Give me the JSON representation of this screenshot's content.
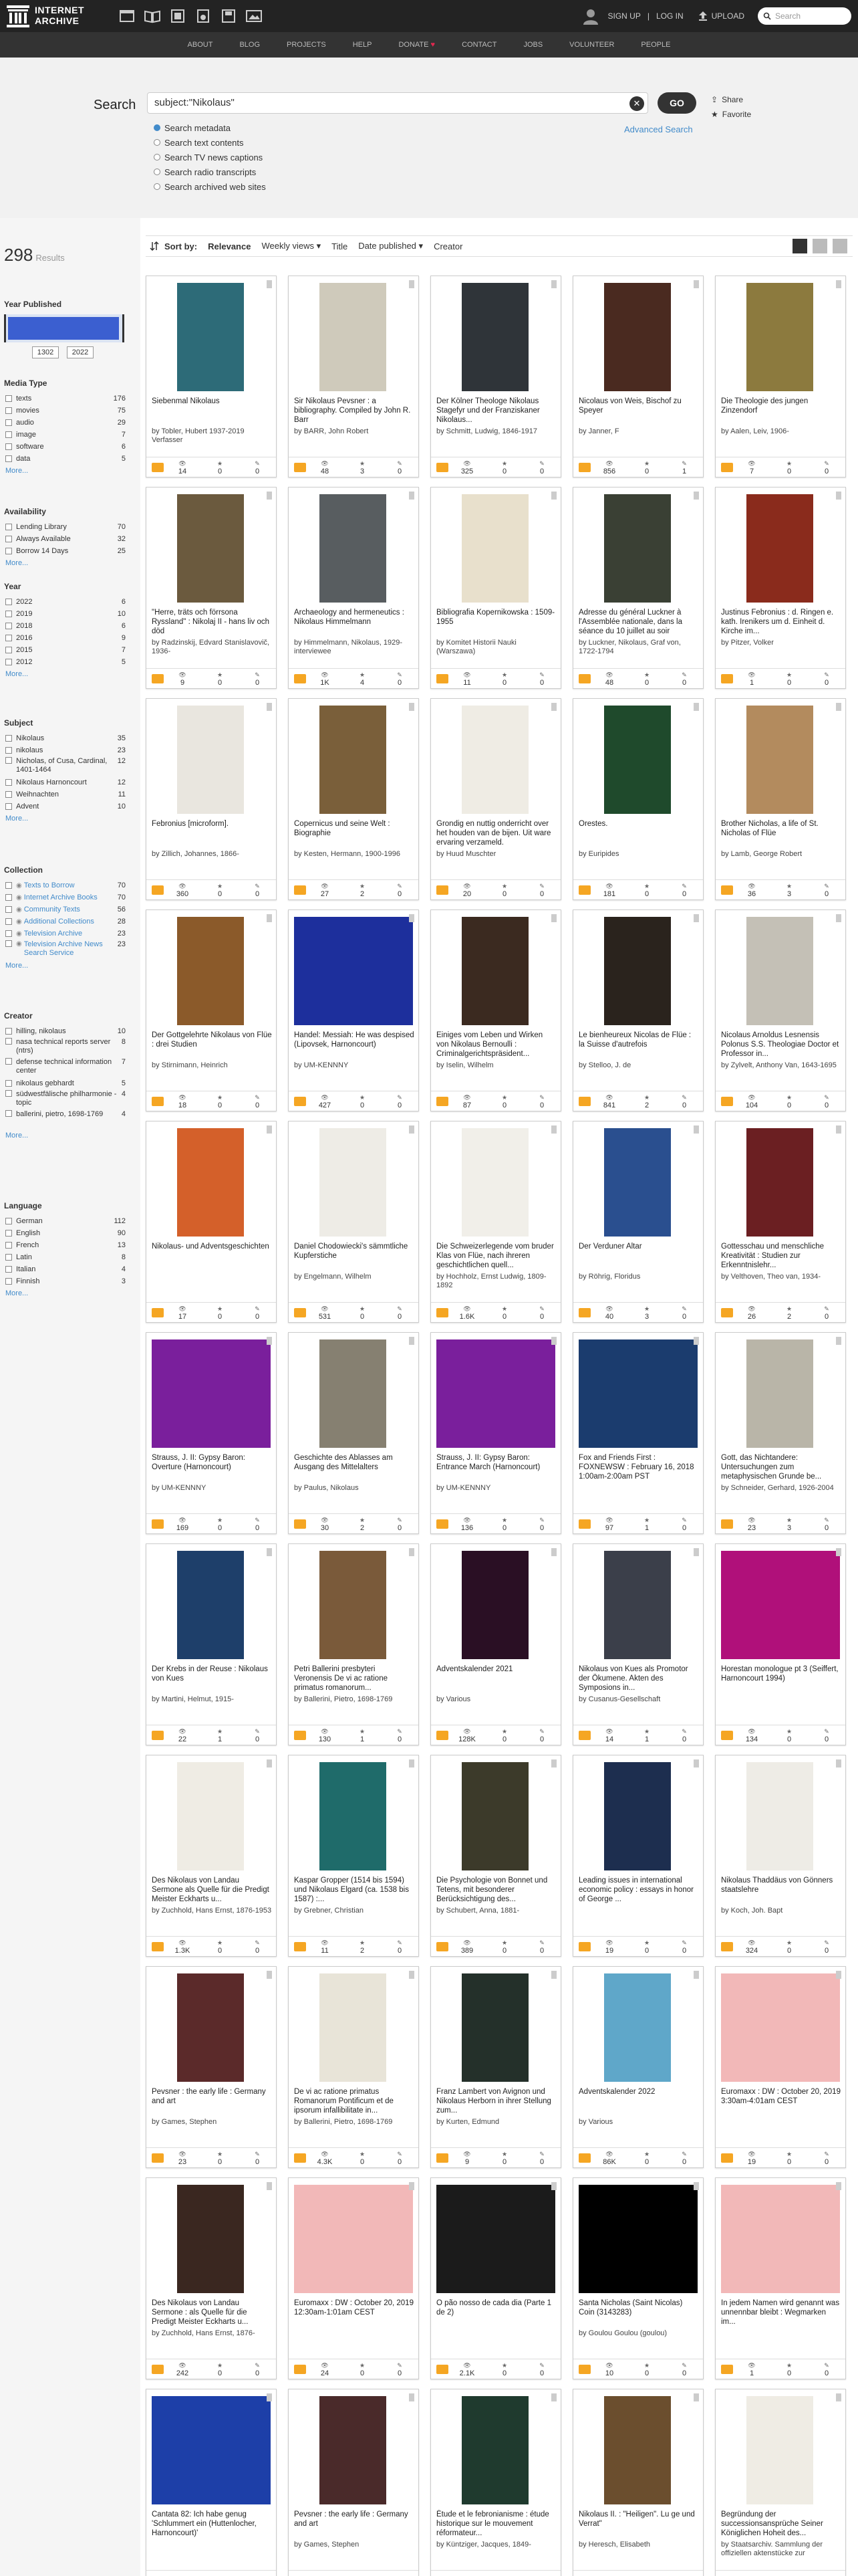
{
  "header": {
    "logo_text_1": "INTERNET",
    "logo_text_2": "ARCHIVE",
    "signup": "SIGN UP",
    "login": "LOG IN",
    "upload": "UPLOAD",
    "search_placeholder": "Search",
    "nav": [
      "ABOUT",
      "BLOG",
      "PROJECTS",
      "HELP",
      "DONATE",
      "CONTACT",
      "JOBS",
      "VOLUNTEER",
      "PEOPLE"
    ]
  },
  "search": {
    "label": "Search",
    "query": "subject:\"Nikolaus\"",
    "go": "GO",
    "advanced": "Advanced Search",
    "share": "Share",
    "favorite": "Favorite",
    "options": [
      "Search metadata",
      "Search text contents",
      "Search TV news captions",
      "Search radio transcripts",
      "Search archived web sites"
    ]
  },
  "results": {
    "count": "298",
    "label": "Results"
  },
  "sort": {
    "label": "Sort by:",
    "options": [
      "Relevance",
      "Weekly views",
      "Title",
      "Date published",
      "Creator"
    ]
  },
  "facets": {
    "year_title": "Year Published",
    "year_from": "1302",
    "year_to": "2022",
    "media_title": "Media Type",
    "media": [
      [
        "texts",
        "176"
      ],
      [
        "movies",
        "75"
      ],
      [
        "audio",
        "29"
      ],
      [
        "image",
        "7"
      ],
      [
        "software",
        "6"
      ],
      [
        "data",
        "5"
      ]
    ],
    "avail_title": "Availability",
    "avail": [
      [
        "Lending Library",
        "70"
      ],
      [
        "Always Available",
        "32"
      ],
      [
        "Borrow 14 Days",
        "25"
      ]
    ],
    "year2_title": "Year",
    "years": [
      [
        "2022",
        "6"
      ],
      [
        "2019",
        "10"
      ],
      [
        "2018",
        "6"
      ],
      [
        "2016",
        "9"
      ],
      [
        "2015",
        "7"
      ],
      [
        "2012",
        "5"
      ]
    ],
    "subject_title": "Subject",
    "subjects": [
      [
        "Nikolaus",
        "35"
      ],
      [
        "nikolaus",
        "23"
      ],
      [
        "Nicholas, of Cusa, Cardinal, 1401-1464",
        "12"
      ],
      [
        "Nikolaus Harnoncourt",
        "12"
      ],
      [
        "Weihnachten",
        "11"
      ],
      [
        "Advent",
        "10"
      ]
    ],
    "collection_title": "Collection",
    "collections": [
      [
        "Texts to Borrow",
        "70"
      ],
      [
        "Internet Archive Books",
        "70"
      ],
      [
        "Community Texts",
        "56"
      ],
      [
        "Additional Collections",
        "28"
      ],
      [
        "Television Archive",
        "23"
      ],
      [
        "Television Archive News Search Service",
        "23"
      ]
    ],
    "creator_title": "Creator",
    "creators": [
      [
        "hilling, nikolaus",
        "10"
      ],
      [
        "nasa technical reports server (ntrs)",
        "8"
      ],
      [
        "defense technical information center",
        "7"
      ],
      [
        "nikolaus gebhardt",
        "5"
      ],
      [
        "südwestfälische philharmonie - topic",
        "4"
      ],
      [
        "ballerini, pietro, 1698-1769",
        "4"
      ]
    ],
    "language_title": "Language",
    "languages": [
      [
        "German",
        "112"
      ],
      [
        "English",
        "90"
      ],
      [
        "French",
        "13"
      ],
      [
        "Latin",
        "8"
      ],
      [
        "Italian",
        "4"
      ],
      [
        "Finnish",
        "3"
      ]
    ],
    "more": "More..."
  },
  "items": [
    {
      "title": "Siebenmal Nikolaus",
      "by": "by Tobler, Hubert 1937-2019 Verfasser",
      "views": "14",
      "favs": "0",
      "reviews": "0",
      "color": "#2d6b78"
    },
    {
      "title": "Sir Nikolaus Pevsner : a bibliography. Compiled by John R. Barr",
      "by": "by BARR, John Robert",
      "views": "48",
      "favs": "3",
      "reviews": "0",
      "color": "#cfcabb"
    },
    {
      "title": "Der Kölner Theologe Nikolaus Stagefyr und der Franziskaner Nikolaus...",
      "by": "by Schmitt, Ludwig, 1846-1917",
      "views": "325",
      "favs": "0",
      "reviews": "0",
      "color": "#2f3439"
    },
    {
      "title": "Nicolaus von Weis, Bischof zu Speyer",
      "by": "by Janner, F",
      "views": "856",
      "favs": "0",
      "reviews": "1",
      "color": "#4a2a20"
    },
    {
      "title": "Die Theologie des jungen Zinzendorf",
      "by": "by Aalen, Leiv, 1906-",
      "views": "7",
      "favs": "0",
      "reviews": "0",
      "color": "#8c7a3e"
    },
    {
      "title": "\"Herre, träts och förrsona Ryssland\" : Nikolaj II - hans liv och död",
      "by": "by Radzinskij, Edvard Stanislavovič, 1936-",
      "views": "9",
      "favs": "0",
      "reviews": "0",
      "color": "#6b5a3e"
    },
    {
      "title": "Archaeology and hermeneutics : Nikolaus Himmelmann",
      "by": "by Himmelmann, Nikolaus, 1929- interviewee",
      "views": "1K",
      "favs": "4",
      "reviews": "0",
      "color": "#585d60"
    },
    {
      "title": "Bibliografia Kopernikowska : 1509-1955",
      "by": "by Komitet Historii Nauki (Warszawa)",
      "views": "11",
      "favs": "0",
      "reviews": "0",
      "color": "#e8e0cc"
    },
    {
      "title": "Adresse du général Luckner à l'Assemblée nationale, dans la séance du 10 juillet au soir",
      "by": "by Luckner, Nikolaus, Graf von, 1722-1794",
      "views": "48",
      "favs": "0",
      "reviews": "0",
      "color": "#3a4034"
    },
    {
      "title": "Justinus Febronius : d. Ringen e. kath. Irenikers um d. Einheit d. Kirche im...",
      "by": "by Pitzer, Volker",
      "views": "1",
      "favs": "0",
      "reviews": "0",
      "color": "#8a2b1c"
    },
    {
      "title": "Febronius [microform].",
      "by": "by Zillich, Johannes, 1866-",
      "views": "360",
      "favs": "0",
      "reviews": "0",
      "color": "#e9e6df"
    },
    {
      "title": "Copernicus und seine Welt : Biographie",
      "by": "by Kesten, Hermann, 1900-1996",
      "views": "27",
      "favs": "2",
      "reviews": "0",
      "color": "#7a5f3a"
    },
    {
      "title": "Grondig en nuttig onderricht over het houden van de bijen. Uit ware ervaring verzameld.",
      "by": "by Huud Muschter",
      "views": "20",
      "favs": "0",
      "reviews": "0",
      "color": "#efece4"
    },
    {
      "title": "Orestes.",
      "by": "by Euripides",
      "views": "181",
      "favs": "0",
      "reviews": "0",
      "color": "#1f4a2c"
    },
    {
      "title": "Brother Nicholas, a life of St. Nicholas of Flüe",
      "by": "by Lamb, George Robert",
      "views": "36",
      "favs": "3",
      "reviews": "0",
      "color": "#b38b5e"
    },
    {
      "title": "Der Gottgelehrte Nikolaus von Flüe : drei Studien",
      "by": "by Stirnimann, Heinrich",
      "views": "18",
      "favs": "0",
      "reviews": "0",
      "color": "#8b5a2a"
    },
    {
      "title": "Handel: Messiah: He was despised (Lipovsek, Harnoncourt)",
      "by": "by UM-KENNNY",
      "views": "427",
      "favs": "0",
      "reviews": "0",
      "color": "#1d2f9c",
      "wide": true
    },
    {
      "title": "Einiges vom Leben und Wirken von Nikolaus Bernoulli : Criminalgerichtspräsident...",
      "by": "by Iselin, Wilhelm",
      "views": "87",
      "favs": "0",
      "reviews": "0",
      "color": "#3b2a20"
    },
    {
      "title": "Le bienheureux Nicolas de Flüe : la Suisse d'autrefois",
      "by": "by Stelloo, J. de",
      "views": "841",
      "favs": "2",
      "reviews": "0",
      "color": "#2a231d"
    },
    {
      "title": "Nicolaus Arnoldus Lesnensis Polonus S.S. Theologiae Doctor et Professor in...",
      "by": "by Zylvelt, Anthony Van, 1643-1695",
      "views": "104",
      "favs": "0",
      "reviews": "0",
      "color": "#c4c0b6"
    },
    {
      "title": "Nikolaus- und Adventsgeschichten",
      "by": "",
      "views": "17",
      "favs": "0",
      "reviews": "0",
      "color": "#d4602a"
    },
    {
      "title": "Daniel Chodowiecki's sämmtliche Kupferstiche",
      "by": "by Engelmann, Wilhelm",
      "views": "531",
      "favs": "0",
      "reviews": "0",
      "color": "#eeece6"
    },
    {
      "title": "Die Schweizerlegende vom bruder Klas von Flüe, nach ihreren geschichtlichen quell...",
      "by": "by Hochholz, Ernst Ludwig, 1809-1892",
      "views": "1.6K",
      "favs": "0",
      "reviews": "0",
      "color": "#f1efe9"
    },
    {
      "title": "Der Verduner Altar",
      "by": "by Röhrig, Floridus",
      "views": "40",
      "favs": "3",
      "reviews": "0",
      "color": "#2a4f8f"
    },
    {
      "title": "Gottesschau und menschliche Kreativität : Studien zur Erkenntnislehr...",
      "by": "by Velthoven, Theo van, 1934-",
      "views": "26",
      "favs": "2",
      "reviews": "0",
      "color": "#6b1f22"
    },
    {
      "title": "Strauss, J. II: Gypsy Baron: Overture (Harnoncourt)",
      "by": "by UM-KENNNY",
      "views": "169",
      "favs": "0",
      "reviews": "0",
      "color": "#7a1f9c",
      "wide": true
    },
    {
      "title": "Geschichte des Ablasses am Ausgang des Mittelalters",
      "by": "by Paulus, Nikolaus",
      "views": "30",
      "favs": "2",
      "reviews": "0",
      "color": "#868071"
    },
    {
      "title": "Strauss, J. II: Gypsy Baron: Entrance March (Harnoncourt)",
      "by": "by UM-KENNNY",
      "views": "136",
      "favs": "0",
      "reviews": "0",
      "color": "#7a1f9c",
      "wide": true
    },
    {
      "title": "Fox and Friends First : FOXNEWSW : February 16, 2018 1:00am-2:00am PST",
      "by": "",
      "views": "97",
      "favs": "1",
      "reviews": "0",
      "color": "#1b3c6e",
      "wide": true
    },
    {
      "title": "Gott, das Nichtandere: Untersuchungen zum metaphysischen Grunde be...",
      "by": "by Schneider, Gerhard, 1926-2004",
      "views": "23",
      "favs": "3",
      "reviews": "0",
      "color": "#b9b5a8"
    },
    {
      "title": "Der Krebs in der Reuse : Nikolaus von Kues",
      "by": "by Martini, Helmut, 1915-",
      "views": "22",
      "favs": "1",
      "reviews": "0",
      "color": "#1e3f6a"
    },
    {
      "title": "Petri Ballerini presbyteri Veronensis De vi ac ratione primatus romanorum...",
      "by": "by Ballerini, Pietro, 1698-1769",
      "views": "130",
      "favs": "1",
      "reviews": "0",
      "color": "#7a5a3a"
    },
    {
      "title": "Adventskalender 2021",
      "by": "by Various",
      "views": "128K",
      "favs": "0",
      "reviews": "0",
      "color": "#2a0f24"
    },
    {
      "title": "Nikolaus von Kues als Promotor der Ökumene. Akten des Symposions in...",
      "by": "by Cusanus-Gesellschaft",
      "views": "14",
      "favs": "1",
      "reviews": "0",
      "color": "#3b3f4a"
    },
    {
      "title": "Horestan monologue pt 3 (Seiffert, Harnoncourt 1994)",
      "by": "",
      "views": "134",
      "favs": "0",
      "reviews": "0",
      "color": "#b0107a",
      "wide": true
    },
    {
      "title": "Des Nikolaus von Landau Sermone als Quelle für die Predigt Meister Eckharts u...",
      "by": "by Zuchhold, Hans Ernst, 1876-1953",
      "views": "1.3K",
      "favs": "0",
      "reviews": "0",
      "color": "#efece4"
    },
    {
      "title": "Kaspar Gropper (1514 bis 1594) und Nikolaus Elgard (ca. 1538 bis 1587) :...",
      "by": "by Grebner, Christian",
      "views": "11",
      "favs": "2",
      "reviews": "0",
      "color": "#1f6b6a"
    },
    {
      "title": "Die Psychologie von Bonnet und Tetens, mit besonderer Berücksichtigung des...",
      "by": "by Schubert, Anna, 1881-",
      "views": "389",
      "favs": "0",
      "reviews": "0",
      "color": "#3c3a2a"
    },
    {
      "title": "Leading issues in international economic policy : essays in honor of George ...",
      "by": "",
      "views": "19",
      "favs": "0",
      "reviews": "0",
      "color": "#1d2e4f"
    },
    {
      "title": "Nikolaus Thaddäus von Gönners staatslehre",
      "by": "by Koch, Joh. Bapt",
      "views": "324",
      "favs": "0",
      "reviews": "0",
      "color": "#eeece6"
    },
    {
      "title": "Pevsner : the early life : Germany and art",
      "by": "by Games, Stephen",
      "views": "23",
      "favs": "0",
      "reviews": "0",
      "color": "#5b2a2a"
    },
    {
      "title": "De vi ac ratione primatus Romanorum Pontificum et de ipsorum infallibilitate in...",
      "by": "by Ballerini, Pietro, 1698-1769",
      "views": "4.3K",
      "favs": "0",
      "reviews": "0",
      "color": "#e8e4d8"
    },
    {
      "title": "Franz Lambert von Avignon und Nikolaus Herborn in ihrer Stellung zum...",
      "by": "by Kurten, Edmund",
      "views": "9",
      "favs": "0",
      "reviews": "0",
      "color": "#24302a"
    },
    {
      "title": "Adventskalender 2022",
      "by": "by Various",
      "views": "86K",
      "favs": "0",
      "reviews": "0",
      "color": "#5fa7c9"
    },
    {
      "title": "Euromaxx : DW : October 20, 2019 3:30am-4:01am CEST",
      "by": "",
      "views": "19",
      "favs": "0",
      "reviews": "0",
      "color": "#f2b8b8",
      "wide": true
    },
    {
      "title": "Des Nikolaus von Landau Sermone : als Quelle für die Predigt Meister Eckharts u...",
      "by": "by Zuchhold, Hans Ernst, 1876-",
      "views": "242",
      "favs": "0",
      "reviews": "0",
      "color": "#3a2720"
    },
    {
      "title": "Euromaxx : DW : October 20, 2019 12:30am-1:01am CEST",
      "by": "",
      "views": "24",
      "favs": "0",
      "reviews": "0",
      "color": "#f2b8b8",
      "wide": true
    },
    {
      "title": "O pão nosso de cada dia (Parte 1 de 2)",
      "by": "",
      "views": "2.1K",
      "favs": "0",
      "reviews": "0",
      "color": "#1b1b1b",
      "wide": true
    },
    {
      "title": "Santa Nicholas (Saint Nicolas) Coin (3143283)",
      "by": "by Goulou Goulou (goulou)",
      "views": "10",
      "favs": "0",
      "reviews": "0",
      "color": "#000000",
      "wide": true
    },
    {
      "title": "In jedem Namen wird genannt was unnennbar bleibt : Wegmarken im...",
      "by": "",
      "views": "1",
      "favs": "0",
      "reviews": "0",
      "color": "#f2b8b8",
      "wide": true
    },
    {
      "title": "Cantata 82: Ich habe genug 'Schlummert ein (Huttenlocher, Harnoncourt)'",
      "by": "",
      "views": "",
      "favs": "",
      "reviews": "",
      "color": "#1d3fa8",
      "wide": true
    },
    {
      "title": "Pevsner : the early life : Germany and art",
      "by": "by Games, Stephen",
      "views": "",
      "favs": "",
      "reviews": "",
      "color": "#4a2a2a"
    },
    {
      "title": "Étude et le febronianisme : étude historique sur le mouvement réformateur...",
      "by": "by Küntziger, Jacques, 1849-",
      "views": "",
      "favs": "",
      "reviews": "",
      "color": "#1f3a2e"
    },
    {
      "title": "Nikolaus II. : \"Heiligen\". Lu ge und Verrat\"",
      "by": "by Heresch, Elisabeth",
      "views": "",
      "favs": "",
      "reviews": "",
      "color": "#6b4e2e"
    },
    {
      "title": "Begründung der successionsansprüche Seiner Königlichen Hoheit des...",
      "by": "by Staatsarchiv. Sammlung der offiziellen aktenstücke zur geschichte der gegenwart...",
      "views": "",
      "favs": "",
      "reviews": "",
      "color": "#efece4"
    }
  ]
}
